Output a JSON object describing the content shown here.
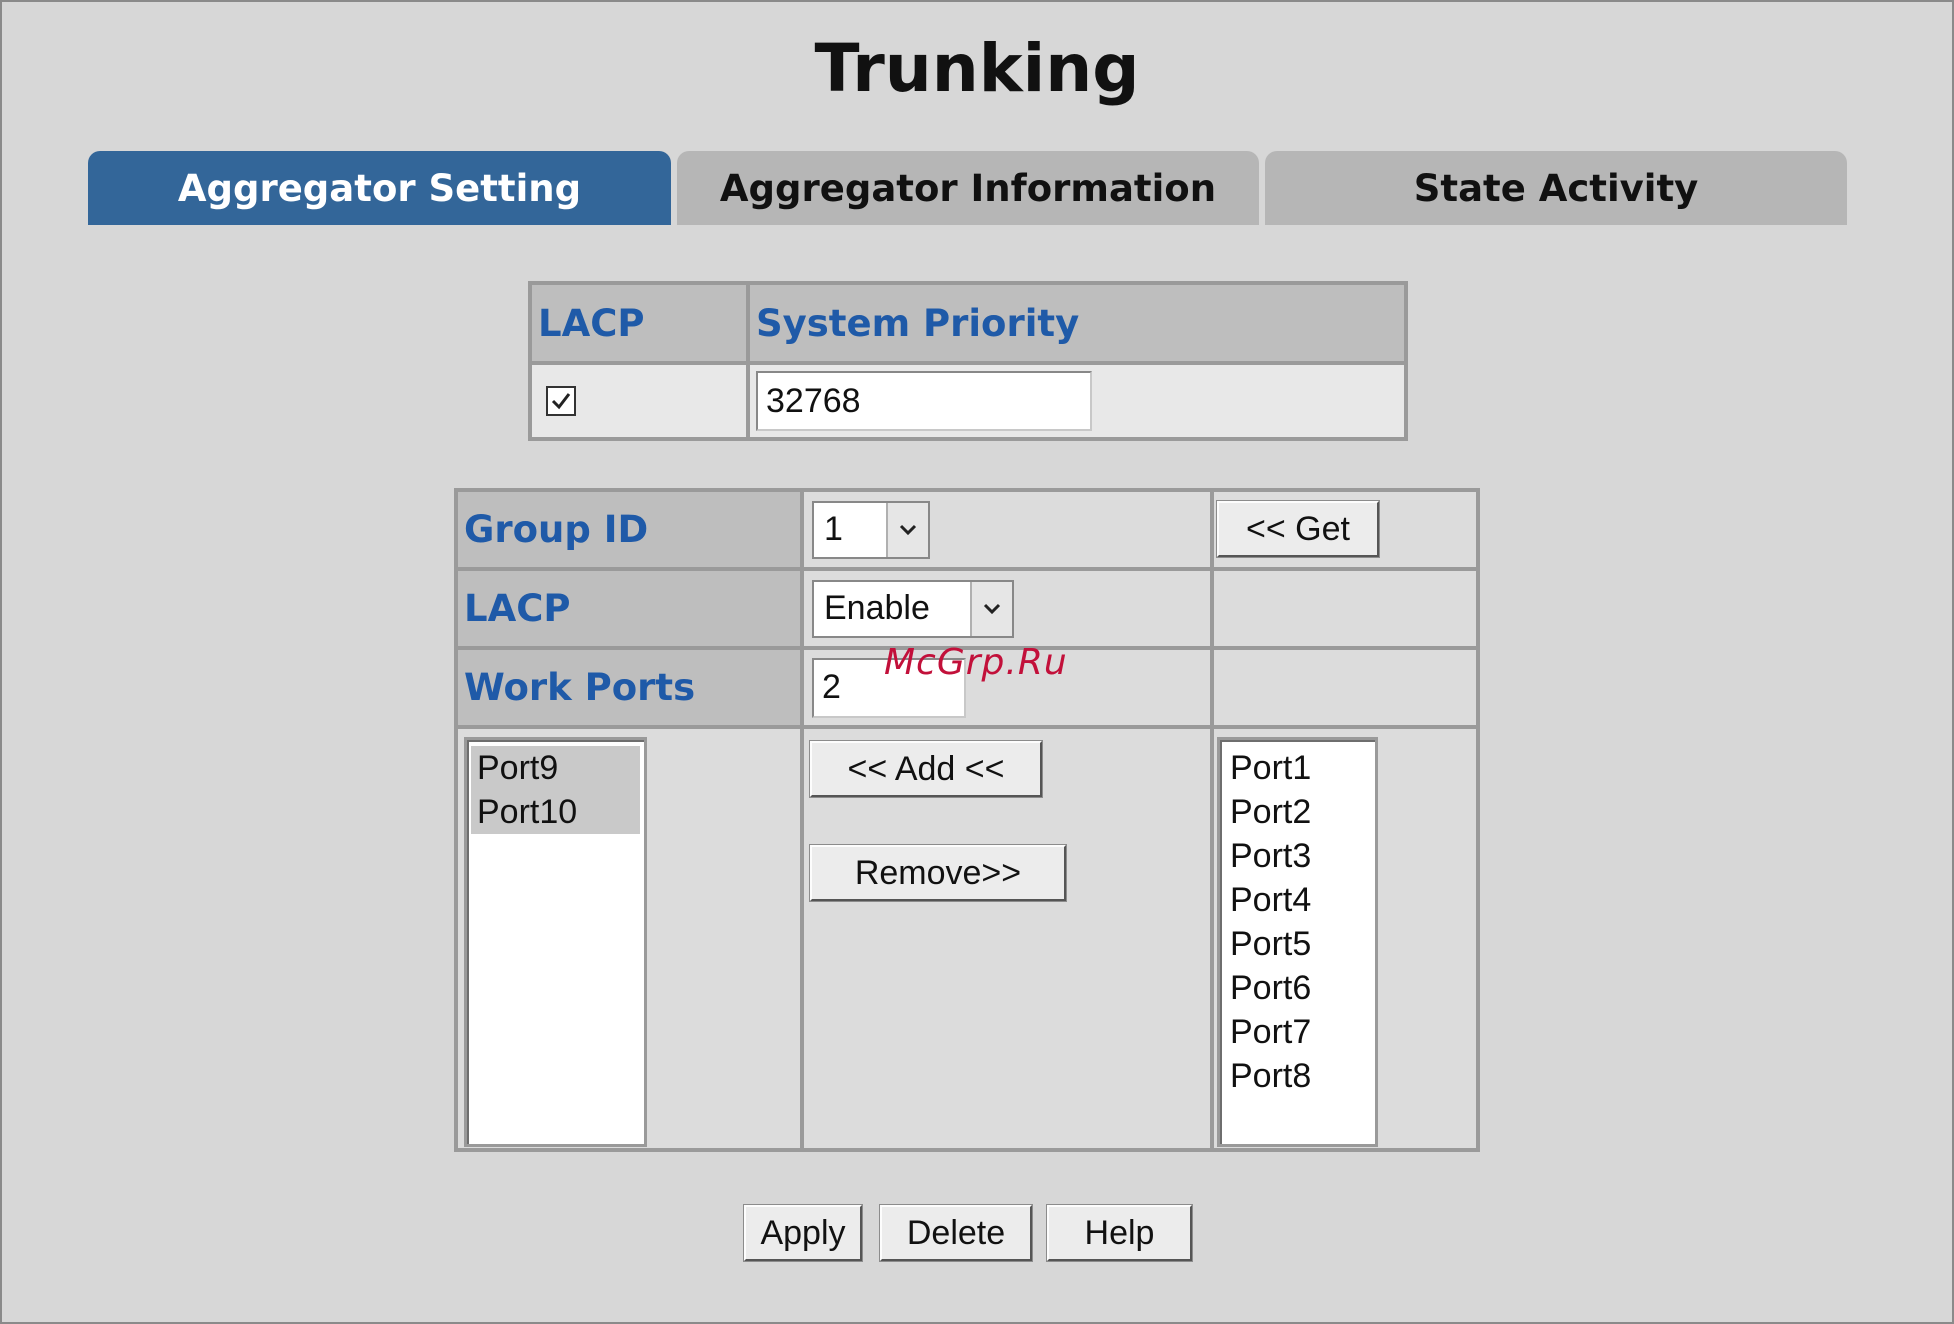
{
  "page": {
    "title": "Trunking"
  },
  "tabs": [
    {
      "label": "Aggregator Setting",
      "active": true
    },
    {
      "label": "Aggregator Information",
      "active": false
    },
    {
      "label": "State Activity",
      "active": false
    }
  ],
  "lacp_system": {
    "col_lacp": "LACP",
    "col_priority": "System Priority",
    "lacp_checked": true,
    "priority_value": "32768"
  },
  "group": {
    "group_id_label": "Group ID",
    "group_id_value": "1",
    "get_button": "<< Get",
    "lacp_label": "LACP",
    "lacp_value": "Enable",
    "work_ports_label": "Work Ports",
    "work_ports_value": "2",
    "member_ports": [
      "Port9",
      "Port10"
    ],
    "add_button": "<< Add <<",
    "remove_button": "Remove>>",
    "available_ports": [
      "Port1",
      "Port2",
      "Port3",
      "Port4",
      "Port5",
      "Port6",
      "Port7",
      "Port8"
    ]
  },
  "actions": {
    "apply": "Apply",
    "delete": "Delete",
    "help": "Help"
  },
  "watermark": "McGrp.Ru",
  "colors": {
    "active_tab": "#336699",
    "label_text": "#1f5aa8",
    "background": "#d7d7d7"
  },
  "icons": {
    "checkbox": "checkmark-icon",
    "dropdown": "chevron-down-icon"
  }
}
